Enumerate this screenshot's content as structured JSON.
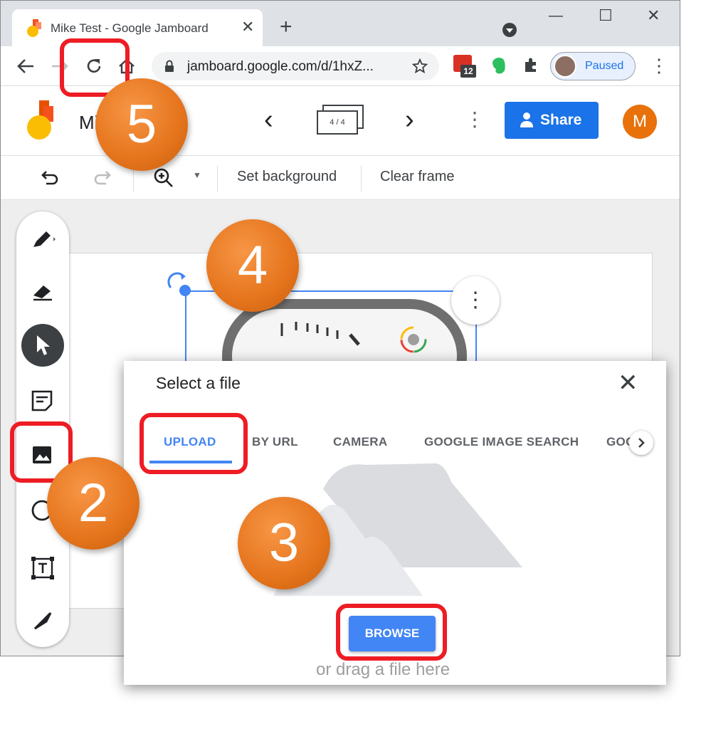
{
  "browser": {
    "tab_title": "Mike Test - Google Jamboard",
    "tab_close": "✕",
    "new_tab": "+",
    "window_controls": {
      "minimize": "—",
      "maximize": "☐",
      "close": "✕"
    },
    "url": "jamboard.google.com/d/1hxZ...",
    "calendar_badge": "12",
    "profile_status": "Paused"
  },
  "jamboard": {
    "title": "Mi",
    "frame_counter": "4 / 4",
    "prev_frame": "‹",
    "next_frame": "›",
    "more_menu": "⋮",
    "share_label": "Share",
    "avatar_letter": "M",
    "toolbar": {
      "set_background": "Set background",
      "clear_frame": "Clear frame"
    }
  },
  "dialog": {
    "title": "Select a file",
    "close": "✕",
    "tabs": [
      {
        "label": "UPLOAD"
      },
      {
        "label": "BY URL"
      },
      {
        "label": "CAMERA"
      },
      {
        "label": "GOOGLE IMAGE SEARCH"
      },
      {
        "label": "GOC"
      }
    ],
    "browse_label": "BROWSE",
    "drag_hint": "or drag a file here"
  },
  "callouts": {
    "step_5": "5",
    "step_4": "4",
    "step_2": "2",
    "step_3": "3"
  },
  "colors": {
    "accent_blue": "#1a73e8",
    "callout_orange": "#e5741c",
    "highlight_red": "#ee1c24"
  }
}
